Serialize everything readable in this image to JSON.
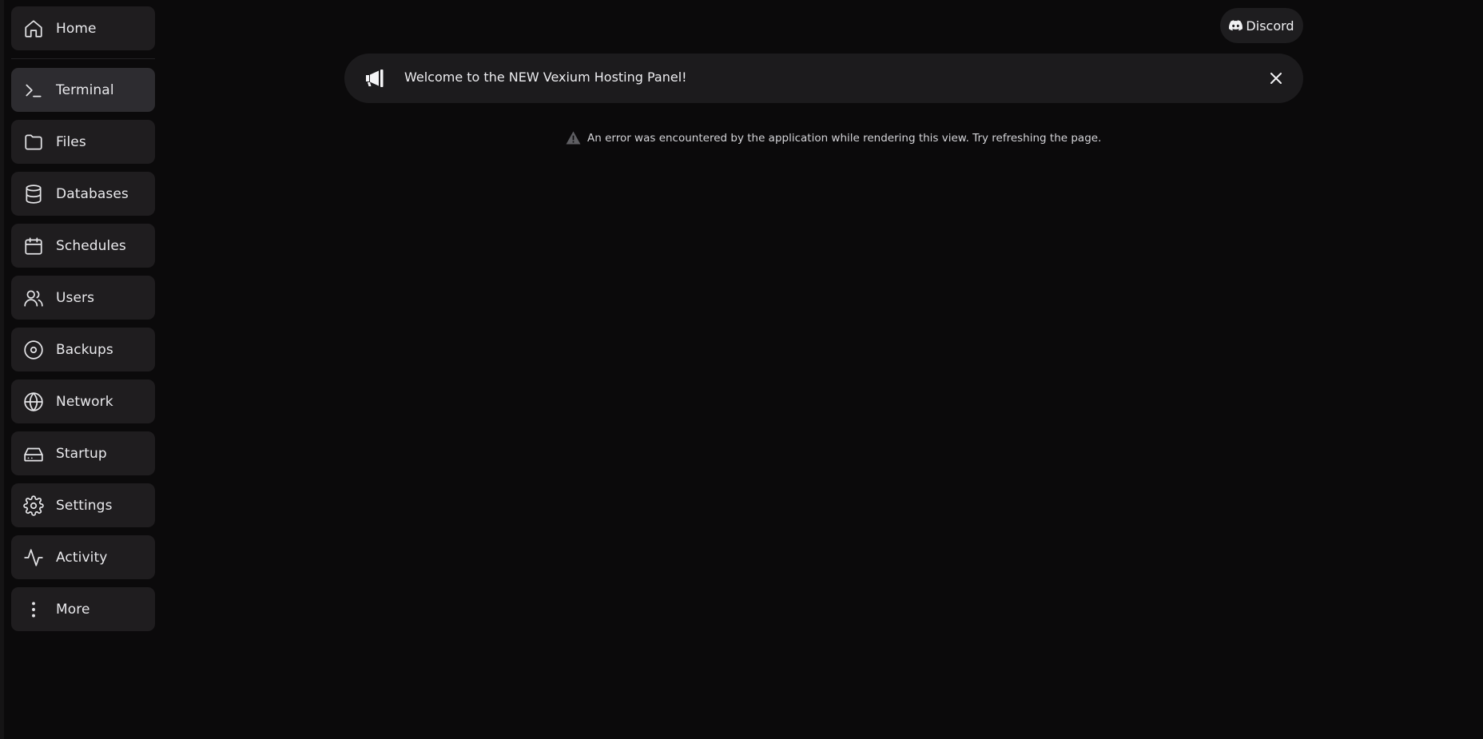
{
  "sidebar": {
    "items": [
      {
        "label": "Home",
        "icon": "home-icon"
      },
      {
        "label": "Terminal",
        "icon": "terminal-icon"
      },
      {
        "label": "Files",
        "icon": "folder-icon"
      },
      {
        "label": "Databases",
        "icon": "database-icon"
      },
      {
        "label": "Schedules",
        "icon": "calendar-icon"
      },
      {
        "label": "Users",
        "icon": "users-icon"
      },
      {
        "label": "Backups",
        "icon": "disc-icon"
      },
      {
        "label": "Network",
        "icon": "globe-icon"
      },
      {
        "label": "Startup",
        "icon": "hard-drive-icon"
      },
      {
        "label": "Settings",
        "icon": "gear-icon"
      },
      {
        "label": "Activity",
        "icon": "activity-icon"
      },
      {
        "label": "More",
        "icon": "more-vertical-icon"
      }
    ],
    "active": "Terminal"
  },
  "header": {
    "discord_label": "Discord"
  },
  "announcement": {
    "text": "Welcome to the NEW Vexium Hosting Panel!"
  },
  "error": {
    "message": "An error was encountered by the application while rendering this view. Try refreshing the page."
  },
  "colors": {
    "background": "#0b0a0b",
    "nav_item": "#1f1d1f",
    "nav_item_active": "#2d2c30",
    "text": "#e4e4e7"
  }
}
